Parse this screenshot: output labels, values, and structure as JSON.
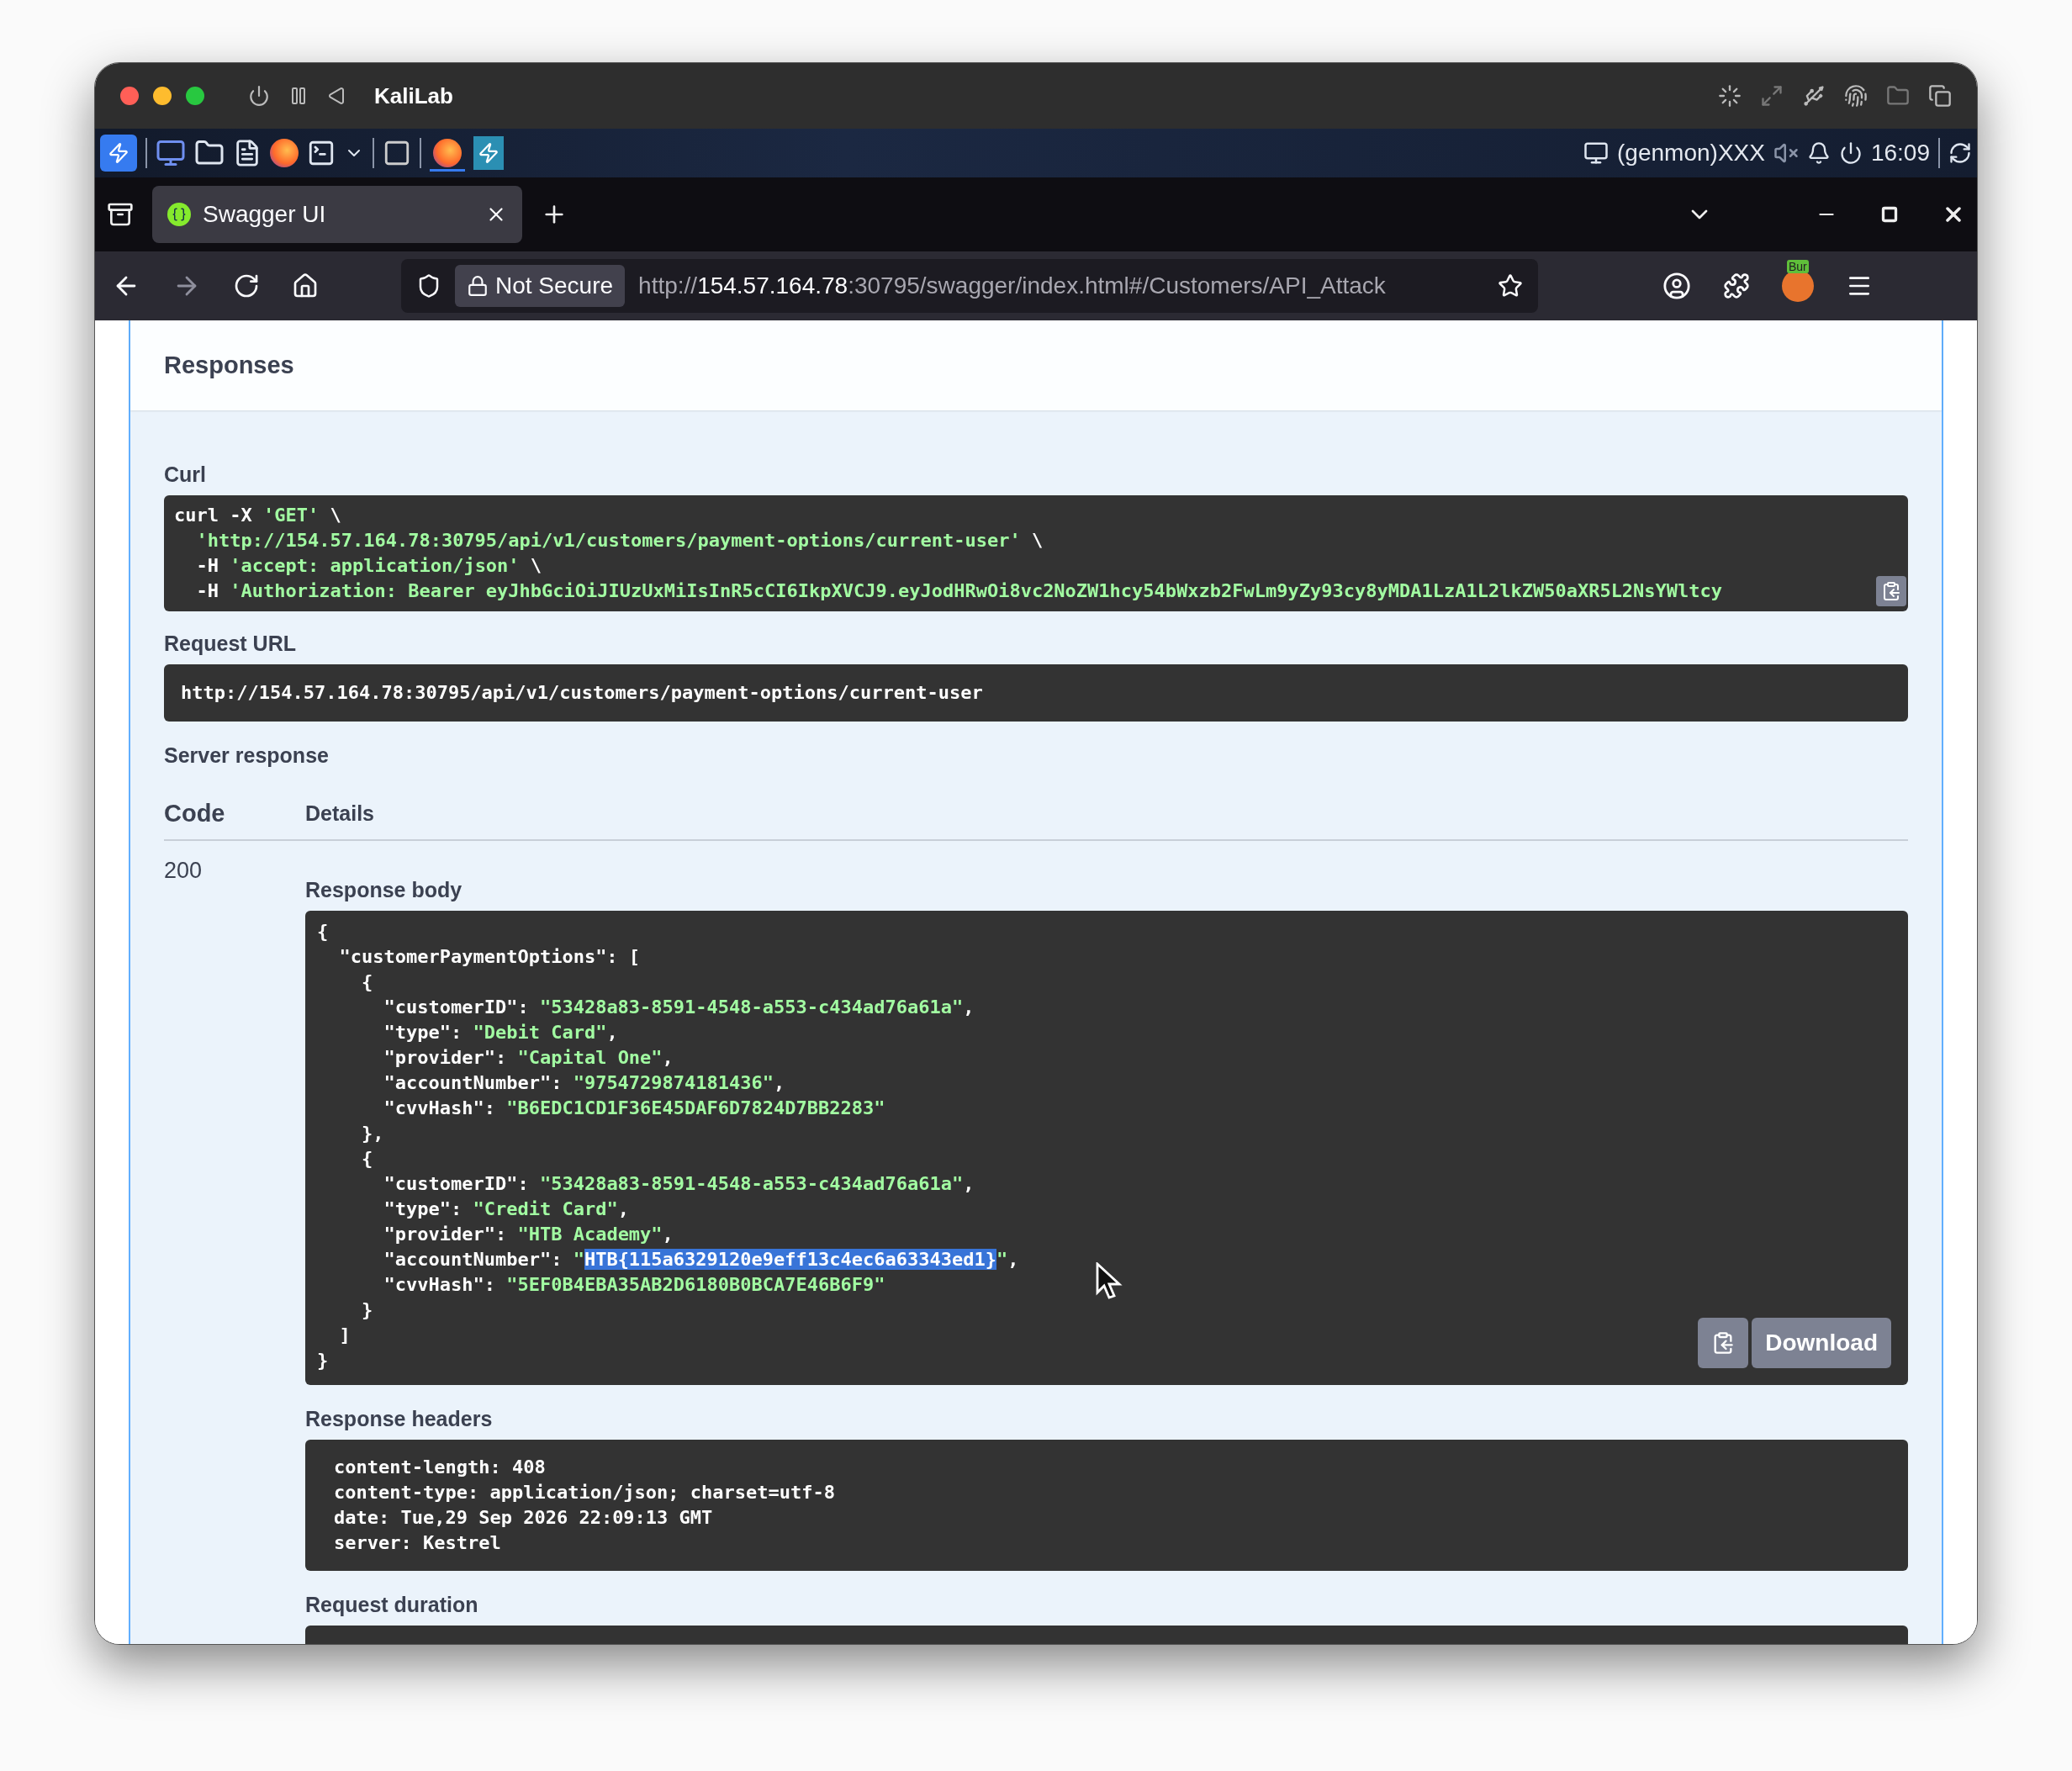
{
  "window": {
    "title": "KaliLab"
  },
  "panel": {
    "monitor_label": "(genmon)XXX",
    "clock": "16:09"
  },
  "tabs": [
    {
      "title": "Swagger UI",
      "selected": true
    }
  ],
  "address_bar": {
    "security_label": "Not Secure",
    "scheme": "http://",
    "host": "154.57.164.78",
    "rest": ":30795/swagger/index.html#/Customers/API_Attack"
  },
  "extension_badge": "Bur",
  "responses": {
    "title": "Responses",
    "curl": {
      "label": "Curl",
      "lines": [
        [
          {
            "kind": "plain",
            "text": "curl -X "
          },
          {
            "kind": "string",
            "text": "'GET'"
          },
          {
            "kind": "plain",
            "text": " \\"
          }
        ],
        [
          {
            "kind": "string",
            "text": "  'http://154.57.164.78:30795/api/v1/customers/payment-options/current-user'"
          },
          {
            "kind": "plain",
            "text": " \\"
          }
        ],
        [
          {
            "kind": "plain",
            "text": "  -H "
          },
          {
            "kind": "string",
            "text": "'accept: application/json'"
          },
          {
            "kind": "plain",
            "text": " \\"
          }
        ],
        [
          {
            "kind": "plain",
            "text": "  -H "
          },
          {
            "kind": "string",
            "text": "'Authorization: Bearer eyJhbGciOiJIUzUxMiIsInR5cCI6IkpXVCJ9.eyJodHRwOi8vc2NoZW1hcy54bWxzb2FwLm9yZy93cy8yMDA1LzA1L2lkZW50aXR5L2NsYWltcy"
          }
        ]
      ]
    },
    "request_url": {
      "label": "Request URL",
      "value": "http://154.57.164.78:30795/api/v1/customers/payment-options/current-user"
    },
    "server_response": {
      "label": "Server response",
      "columns": [
        "Code",
        "Details"
      ],
      "code": "200",
      "body_label": "Response body",
      "body_lines": [
        [
          {
            "kind": "plain",
            "text": "{"
          }
        ],
        [
          {
            "kind": "plain",
            "text": "  \"customerPaymentOptions\": ["
          }
        ],
        [
          {
            "kind": "plain",
            "text": "    {"
          }
        ],
        [
          {
            "kind": "plain",
            "text": "      \"customerID\": "
          },
          {
            "kind": "string",
            "text": "\"53428a83-8591-4548-a553-c434ad76a61a\""
          },
          {
            "kind": "plain",
            "text": ","
          }
        ],
        [
          {
            "kind": "plain",
            "text": "      \"type\": "
          },
          {
            "kind": "string",
            "text": "\"Debit Card\""
          },
          {
            "kind": "plain",
            "text": ","
          }
        ],
        [
          {
            "kind": "plain",
            "text": "      \"provider\": "
          },
          {
            "kind": "string",
            "text": "\"Capital One\""
          },
          {
            "kind": "plain",
            "text": ","
          }
        ],
        [
          {
            "kind": "plain",
            "text": "      \"accountNumber\": "
          },
          {
            "kind": "string",
            "text": "\"9754729874181436\""
          },
          {
            "kind": "plain",
            "text": ","
          }
        ],
        [
          {
            "kind": "plain",
            "text": "      \"cvvHash\": "
          },
          {
            "kind": "string",
            "text": "\"B6EDC1CD1F36E45DAF6D7824D7BB2283\""
          }
        ],
        [
          {
            "kind": "plain",
            "text": "    },"
          }
        ],
        [
          {
            "kind": "plain",
            "text": "    {"
          }
        ],
        [
          {
            "kind": "plain",
            "text": "      \"customerID\": "
          },
          {
            "kind": "string",
            "text": "\"53428a83-8591-4548-a553-c434ad76a61a\""
          },
          {
            "kind": "plain",
            "text": ","
          }
        ],
        [
          {
            "kind": "plain",
            "text": "      \"type\": "
          },
          {
            "kind": "string",
            "text": "\"Credit Card\""
          },
          {
            "kind": "plain",
            "text": ","
          }
        ],
        [
          {
            "kind": "plain",
            "text": "      \"provider\": "
          },
          {
            "kind": "string",
            "text": "\"HTB Academy\""
          },
          {
            "kind": "plain",
            "text": ","
          }
        ],
        [
          {
            "kind": "plain",
            "text": "      \"accountNumber\": "
          },
          {
            "kind": "string",
            "text": "\""
          },
          {
            "kind": "selected",
            "text": "HTB{115a6329120e9eff13c4ec6a63343ed1}"
          },
          {
            "kind": "string",
            "text": "\""
          },
          {
            "kind": "plain",
            "text": ","
          }
        ],
        [
          {
            "kind": "plain",
            "text": "      \"cvvHash\": "
          },
          {
            "kind": "string",
            "text": "\"5EF0B4EBA35AB2D6180B0BCA7E46B6F9\""
          }
        ],
        [
          {
            "kind": "plain",
            "text": "    }"
          }
        ],
        [
          {
            "kind": "plain",
            "text": "  ]"
          }
        ],
        [
          {
            "kind": "plain",
            "text": "}"
          }
        ]
      ],
      "download_label": "Download",
      "headers_label": "Response headers",
      "headers": [
        "content-length: 408",
        "content-type: application/json; charset=utf-8",
        "date: Tue,29 Sep 2026 22:09:13 GMT",
        "server: Kestrel"
      ],
      "duration_label": "Request duration"
    }
  }
}
